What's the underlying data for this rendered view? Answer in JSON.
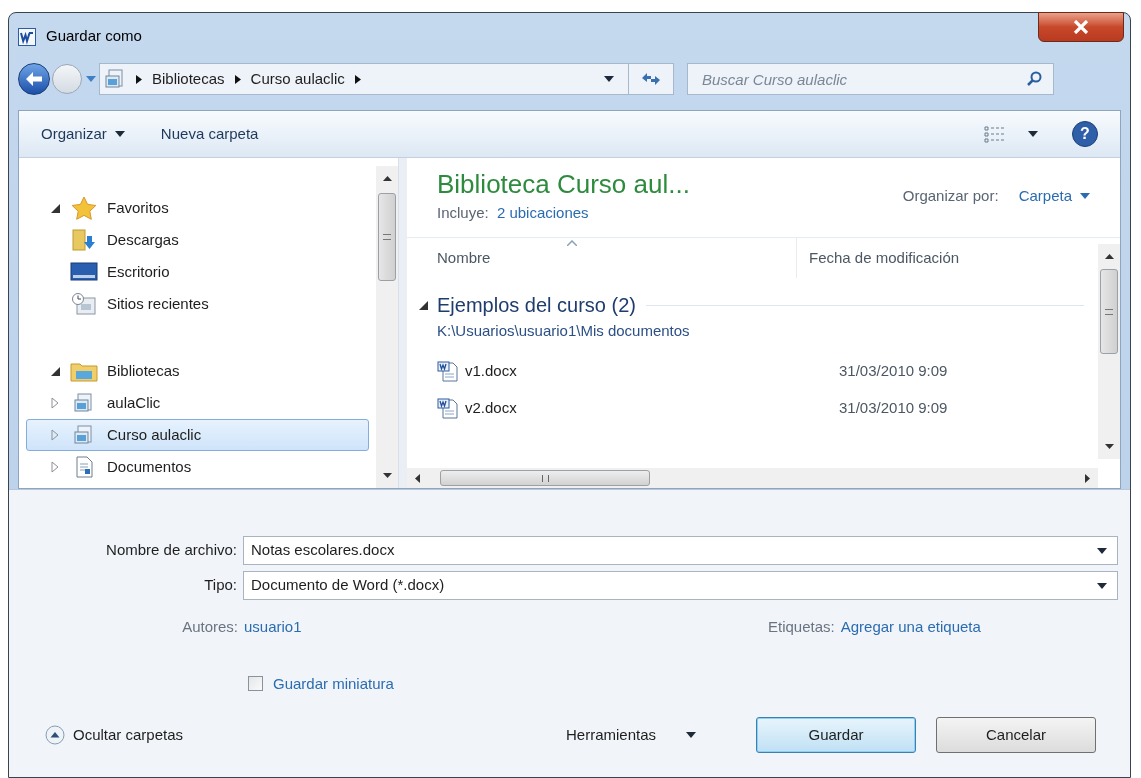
{
  "window": {
    "title": "Guardar como"
  },
  "address_bar": {
    "breadcrumbs": [
      "Bibliotecas",
      "Curso aulaclic"
    ]
  },
  "search": {
    "placeholder": "Buscar Curso aulaclic"
  },
  "toolbar": {
    "buttons": [
      {
        "label": "Organizar",
        "kind": "menu"
      },
      {
        "label": "Nueva carpeta",
        "kind": "plain"
      }
    ],
    "help": "?"
  },
  "navigation": {
    "groups": [
      {
        "label": "Favoritos",
        "kind": "favorites",
        "expanded": true,
        "selected": false,
        "children": [
          {
            "label": "Descargas",
            "kind": "downloads",
            "selected": false
          },
          {
            "label": "Escritorio",
            "kind": "desktop",
            "selected": false
          },
          {
            "label": "Sitios recientes",
            "kind": "recent",
            "selected": false
          }
        ]
      },
      {
        "label": "Bibliotecas",
        "kind": "libraries",
        "expanded": true,
        "selected": false,
        "children": [
          {
            "label": "aulaClic",
            "kind": "library",
            "expanded": false,
            "selected": false
          },
          {
            "label": "Curso aulaclic",
            "kind": "library",
            "expanded": false,
            "selected": true
          },
          {
            "label": "Documentos",
            "kind": "document",
            "expanded": false,
            "selected": false
          }
        ]
      }
    ]
  },
  "library": {
    "title": "Biblioteca Curso aul...",
    "includes_label": "Incluye:",
    "includes_link": "2 ubicaciones",
    "arrange_label": "Organizar por:",
    "arrange_value": "Carpeta"
  },
  "file_list": {
    "columns": [
      "Nombre",
      "Fecha de modificación"
    ],
    "groups": [
      {
        "label": "Ejemplos del curso (2)",
        "path": "K:\\Usuarios\\usuario1\\Mis documentos",
        "expanded": true,
        "files": [
          {
            "name": "v1.docx",
            "modified": "31/03/2010 9:09"
          },
          {
            "name": "v2.docx",
            "modified": "31/03/2010 9:09"
          }
        ]
      }
    ]
  },
  "form": {
    "file_name": {
      "label": "Nombre de archivo:",
      "value": "Notas escolares.docx"
    },
    "type": {
      "label": "Tipo:",
      "value": "Documento de Word (*.docx)"
    },
    "authors": {
      "label": "Autores:",
      "value": "usuario1"
    },
    "tags": {
      "label": "Etiquetas:",
      "value": "Agregar una etiqueta"
    },
    "thumbnail": {
      "label": "Guardar miniatura",
      "checked": false
    }
  },
  "footer": {
    "hide_folders": "Ocultar carpetas",
    "tools": "Herramientas",
    "buttons": [
      {
        "label": "Guardar",
        "default": true
      },
      {
        "label": "Cancelar",
        "default": false
      }
    ]
  }
}
